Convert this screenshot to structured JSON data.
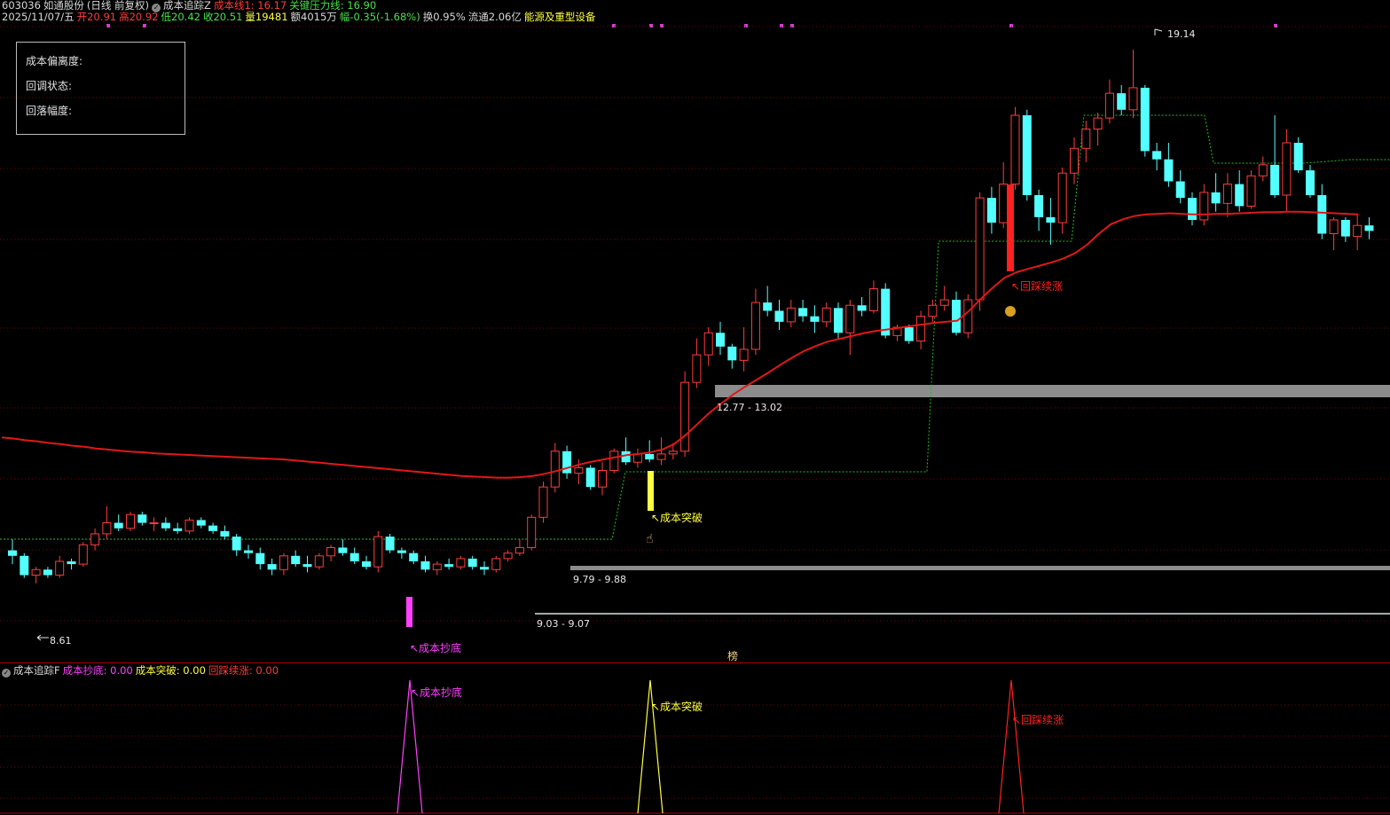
{
  "header": {
    "line1": {
      "code": "603036",
      "name": "如通股份",
      "period": "(日线 前复权)",
      "indicator": "成本追踪Z",
      "cost_line_label": "成本线1: 16.17",
      "pressure_label": "关键压力线: 16.90"
    },
    "line2": {
      "date": "2025/11/07/五",
      "open": "开20.91",
      "high": "高20.92",
      "low": "低20.42",
      "close": "收20.51",
      "volume": "量19481",
      "amount": "额4015万",
      "change": "幅-0.35(-1.68%)",
      "turnover": "换0.95%",
      "float": "流通2.06亿",
      "sector": "能源及重型设备"
    }
  },
  "info_box": {
    "deviation_label": "成本偏离度:",
    "pullback_status_label": "回调状态:",
    "drop_ratio_label": "回落幅度:"
  },
  "main_chart": {
    "high_label": "19.14",
    "low_label": "8.61",
    "zones": [
      {
        "label": "12.77 - 13.02"
      },
      {
        "label": "9.79 - 9.88"
      },
      {
        "label": "9.03 - 9.07"
      }
    ],
    "signals": {
      "bottom": "成本抄底",
      "breakout": "成本突破",
      "pullback": "回踩续涨"
    },
    "marker_char": "榜"
  },
  "sub_chart": {
    "title": "成本追踪F",
    "bottom_label": "成本抄底: 0.00",
    "breakout_label": "成本突破: 0.00",
    "pullback_label": "回踩续涨: 0.00"
  },
  "colors": {
    "up": "#ff3c3c",
    "down": "#54ffff",
    "cost_line": "#e01818",
    "pressure_line": "#20c020",
    "zone": "#8c8c8c",
    "bottom_signal": "#ff40ff",
    "breakout_signal": "#ffff40",
    "pullback_signal": "#ff2020"
  },
  "candles": [
    [
      10.05,
      10.25,
      9.8,
      9.95
    ],
    [
      9.95,
      10.0,
      9.55,
      9.6
    ],
    [
      9.6,
      9.75,
      9.45,
      9.7
    ],
    [
      9.7,
      9.75,
      9.55,
      9.6
    ],
    [
      9.6,
      9.95,
      9.55,
      9.85
    ],
    [
      9.85,
      9.9,
      9.7,
      9.8
    ],
    [
      9.8,
      10.2,
      9.75,
      10.15
    ],
    [
      10.15,
      10.45,
      10.05,
      10.35
    ],
    [
      10.35,
      10.85,
      10.25,
      10.55
    ],
    [
      10.55,
      10.7,
      10.4,
      10.45
    ],
    [
      10.45,
      10.75,
      10.4,
      10.7
    ],
    [
      10.7,
      10.75,
      10.5,
      10.55
    ],
    [
      10.55,
      10.65,
      10.4,
      10.55
    ],
    [
      10.55,
      10.65,
      10.4,
      10.45
    ],
    [
      10.45,
      10.55,
      10.35,
      10.4
    ],
    [
      10.4,
      10.65,
      10.35,
      10.6
    ],
    [
      10.6,
      10.65,
      10.45,
      10.5
    ],
    [
      10.5,
      10.55,
      10.35,
      10.4
    ],
    [
      10.4,
      10.5,
      10.25,
      10.3
    ],
    [
      10.3,
      10.35,
      9.95,
      10.05
    ],
    [
      10.05,
      10.15,
      9.9,
      10.0
    ],
    [
      10.0,
      10.1,
      9.7,
      9.8
    ],
    [
      9.8,
      9.9,
      9.6,
      9.7
    ],
    [
      9.7,
      10.0,
      9.6,
      9.95
    ],
    [
      9.95,
      10.05,
      9.75,
      9.8
    ],
    [
      9.8,
      9.95,
      9.65,
      9.75
    ],
    [
      9.75,
      10.0,
      9.7,
      9.95
    ],
    [
      9.95,
      10.15,
      9.85,
      10.1
    ],
    [
      10.1,
      10.25,
      9.95,
      10.0
    ],
    [
      10.0,
      10.1,
      9.8,
      9.85
    ],
    [
      9.85,
      9.95,
      9.7,
      9.75
    ],
    [
      9.75,
      10.4,
      9.65,
      10.3
    ],
    [
      10.3,
      10.35,
      10.0,
      10.05
    ],
    [
      10.05,
      10.1,
      9.9,
      10.0
    ],
    [
      10.0,
      10.05,
      9.8,
      9.85
    ],
    [
      9.85,
      9.95,
      9.65,
      9.7
    ],
    [
      9.7,
      9.85,
      9.6,
      9.8
    ],
    [
      9.8,
      9.9,
      9.7,
      9.75
    ],
    [
      9.75,
      9.95,
      9.7,
      9.9
    ],
    [
      9.9,
      9.95,
      9.7,
      9.75
    ],
    [
      9.75,
      9.85,
      9.6,
      9.7
    ],
    [
      9.7,
      9.95,
      9.65,
      9.9
    ],
    [
      9.9,
      10.05,
      9.85,
      10.0
    ],
    [
      10.0,
      10.25,
      9.95,
      10.1
    ],
    [
      10.1,
      10.7,
      10.05,
      10.65
    ],
    [
      10.65,
      11.3,
      10.55,
      11.2
    ],
    [
      11.2,
      12.0,
      11.1,
      11.85
    ],
    [
      11.85,
      11.95,
      11.35,
      11.45
    ],
    [
      11.45,
      11.7,
      11.25,
      11.55
    ],
    [
      11.55,
      11.6,
      11.15,
      11.2
    ],
    [
      11.2,
      11.65,
      11.05,
      11.5
    ],
    [
      11.5,
      11.9,
      11.45,
      11.85
    ],
    [
      11.85,
      12.1,
      11.6,
      11.65
    ],
    [
      11.65,
      11.9,
      11.55,
      11.8
    ],
    [
      11.8,
      12.05,
      11.65,
      11.7
    ],
    [
      11.7,
      12.1,
      11.6,
      11.8
    ],
    [
      11.8,
      12.0,
      11.7,
      11.85
    ],
    [
      11.85,
      13.3,
      11.75,
      13.1
    ],
    [
      13.1,
      13.9,
      13.0,
      13.6
    ],
    [
      13.6,
      14.1,
      13.4,
      14.0
    ],
    [
      14.0,
      14.2,
      13.6,
      13.75
    ],
    [
      13.75,
      13.8,
      13.35,
      13.5
    ],
    [
      13.5,
      14.1,
      13.3,
      13.7
    ],
    [
      13.7,
      14.8,
      13.6,
      14.55
    ],
    [
      14.55,
      14.85,
      14.3,
      14.4
    ],
    [
      14.4,
      14.6,
      14.05,
      14.2
    ],
    [
      14.2,
      14.6,
      14.1,
      14.45
    ],
    [
      14.45,
      14.6,
      14.2,
      14.3
    ],
    [
      14.3,
      14.5,
      14.0,
      14.2
    ],
    [
      14.2,
      14.55,
      14.1,
      14.45
    ],
    [
      14.45,
      14.55,
      13.9,
      14.0
    ],
    [
      14.0,
      14.6,
      13.6,
      14.5
    ],
    [
      14.5,
      14.65,
      14.3,
      14.4
    ],
    [
      14.4,
      14.95,
      14.35,
      14.8
    ],
    [
      14.8,
      14.9,
      13.9,
      13.95
    ],
    [
      13.95,
      14.15,
      13.85,
      14.1
    ],
    [
      14.1,
      14.15,
      13.8,
      13.85
    ],
    [
      13.85,
      14.4,
      13.7,
      14.3
    ],
    [
      14.3,
      14.6,
      14.2,
      14.5
    ],
    [
      14.5,
      14.85,
      14.4,
      14.6
    ],
    [
      14.6,
      14.75,
      13.95,
      14.0
    ],
    [
      14.0,
      14.7,
      13.9,
      14.6
    ],
    [
      14.6,
      16.55,
      14.4,
      16.45
    ],
    [
      16.45,
      16.65,
      15.8,
      16.0
    ],
    [
      16.0,
      17.1,
      15.9,
      16.7
    ],
    [
      16.7,
      18.1,
      16.6,
      17.95
    ],
    [
      17.95,
      18.05,
      16.4,
      16.5
    ],
    [
      16.5,
      16.6,
      15.85,
      16.1
    ],
    [
      16.1,
      16.45,
      15.6,
      16.0
    ],
    [
      16.0,
      17.0,
      15.8,
      16.9
    ],
    [
      16.9,
      17.55,
      16.7,
      17.35
    ],
    [
      17.35,
      17.85,
      17.1,
      17.7
    ],
    [
      17.7,
      18.0,
      17.4,
      17.9
    ],
    [
      17.9,
      18.6,
      17.8,
      18.35
    ],
    [
      18.35,
      18.5,
      17.95,
      18.05
    ],
    [
      18.05,
      19.14,
      17.9,
      18.45
    ],
    [
      18.45,
      18.5,
      17.2,
      17.3
    ],
    [
      17.3,
      17.45,
      16.95,
      17.15
    ],
    [
      17.15,
      17.45,
      16.65,
      16.75
    ],
    [
      16.75,
      16.95,
      16.35,
      16.45
    ],
    [
      16.45,
      16.55,
      15.95,
      16.05
    ],
    [
      16.05,
      16.7,
      15.95,
      16.55
    ],
    [
      16.55,
      16.9,
      16.2,
      16.35
    ],
    [
      16.35,
      16.9,
      16.1,
      16.7
    ],
    [
      16.7,
      16.95,
      16.2,
      16.3
    ],
    [
      16.3,
      16.95,
      16.25,
      16.85
    ],
    [
      16.85,
      17.2,
      16.75,
      17.05
    ],
    [
      17.05,
      17.95,
      16.45,
      16.5
    ],
    [
      16.5,
      17.7,
      16.2,
      17.45
    ],
    [
      17.45,
      17.55,
      16.9,
      16.95
    ],
    [
      16.95,
      17.05,
      16.45,
      16.5
    ],
    [
      16.5,
      16.7,
      15.7,
      15.8
    ],
    [
      15.8,
      16.1,
      15.5,
      16.05
    ],
    [
      16.05,
      16.1,
      15.65,
      15.75
    ],
    [
      15.75,
      16.15,
      15.5,
      15.95
    ],
    [
      15.95,
      16.1,
      15.7,
      15.85
    ]
  ],
  "cost_line_values": [
    12.1,
    12.08,
    12.05,
    12.03,
    12.0,
    11.98,
    11.95,
    11.93,
    11.9,
    11.88,
    11.86,
    11.84,
    11.83,
    11.81,
    11.8,
    11.79,
    11.78,
    11.77,
    11.76,
    11.75,
    11.74,
    11.73,
    11.72,
    11.71,
    11.7,
    11.68,
    11.66,
    11.64,
    11.62,
    11.6,
    11.58,
    11.56,
    11.54,
    11.52,
    11.5,
    11.48,
    11.46,
    11.44,
    11.42,
    11.4,
    11.39,
    11.38,
    11.37,
    11.37,
    11.38,
    11.4,
    11.44,
    11.49,
    11.55,
    11.61,
    11.66,
    11.7,
    11.74,
    11.78,
    11.8,
    11.83,
    11.88,
    11.98,
    12.15,
    12.35,
    12.55,
    12.72,
    12.88,
    13.02,
    13.15,
    13.28,
    13.42,
    13.55,
    13.67,
    13.76,
    13.84,
    13.89,
    13.94,
    13.99,
    14.03,
    14.06,
    14.09,
    14.12,
    14.15,
    14.18,
    14.2,
    14.22,
    14.4,
    14.62,
    14.82,
    15.0,
    15.1,
    15.16,
    15.22,
    15.28,
    15.35,
    15.45,
    15.6,
    15.8,
    15.97,
    16.06,
    16.12,
    16.15,
    16.16,
    16.17,
    16.16,
    16.15,
    16.15,
    16.16,
    16.16,
    16.17,
    16.18,
    16.19,
    16.19,
    16.2,
    16.2,
    16.19,
    16.18,
    16.17,
    16.16,
    16.15
  ]
}
